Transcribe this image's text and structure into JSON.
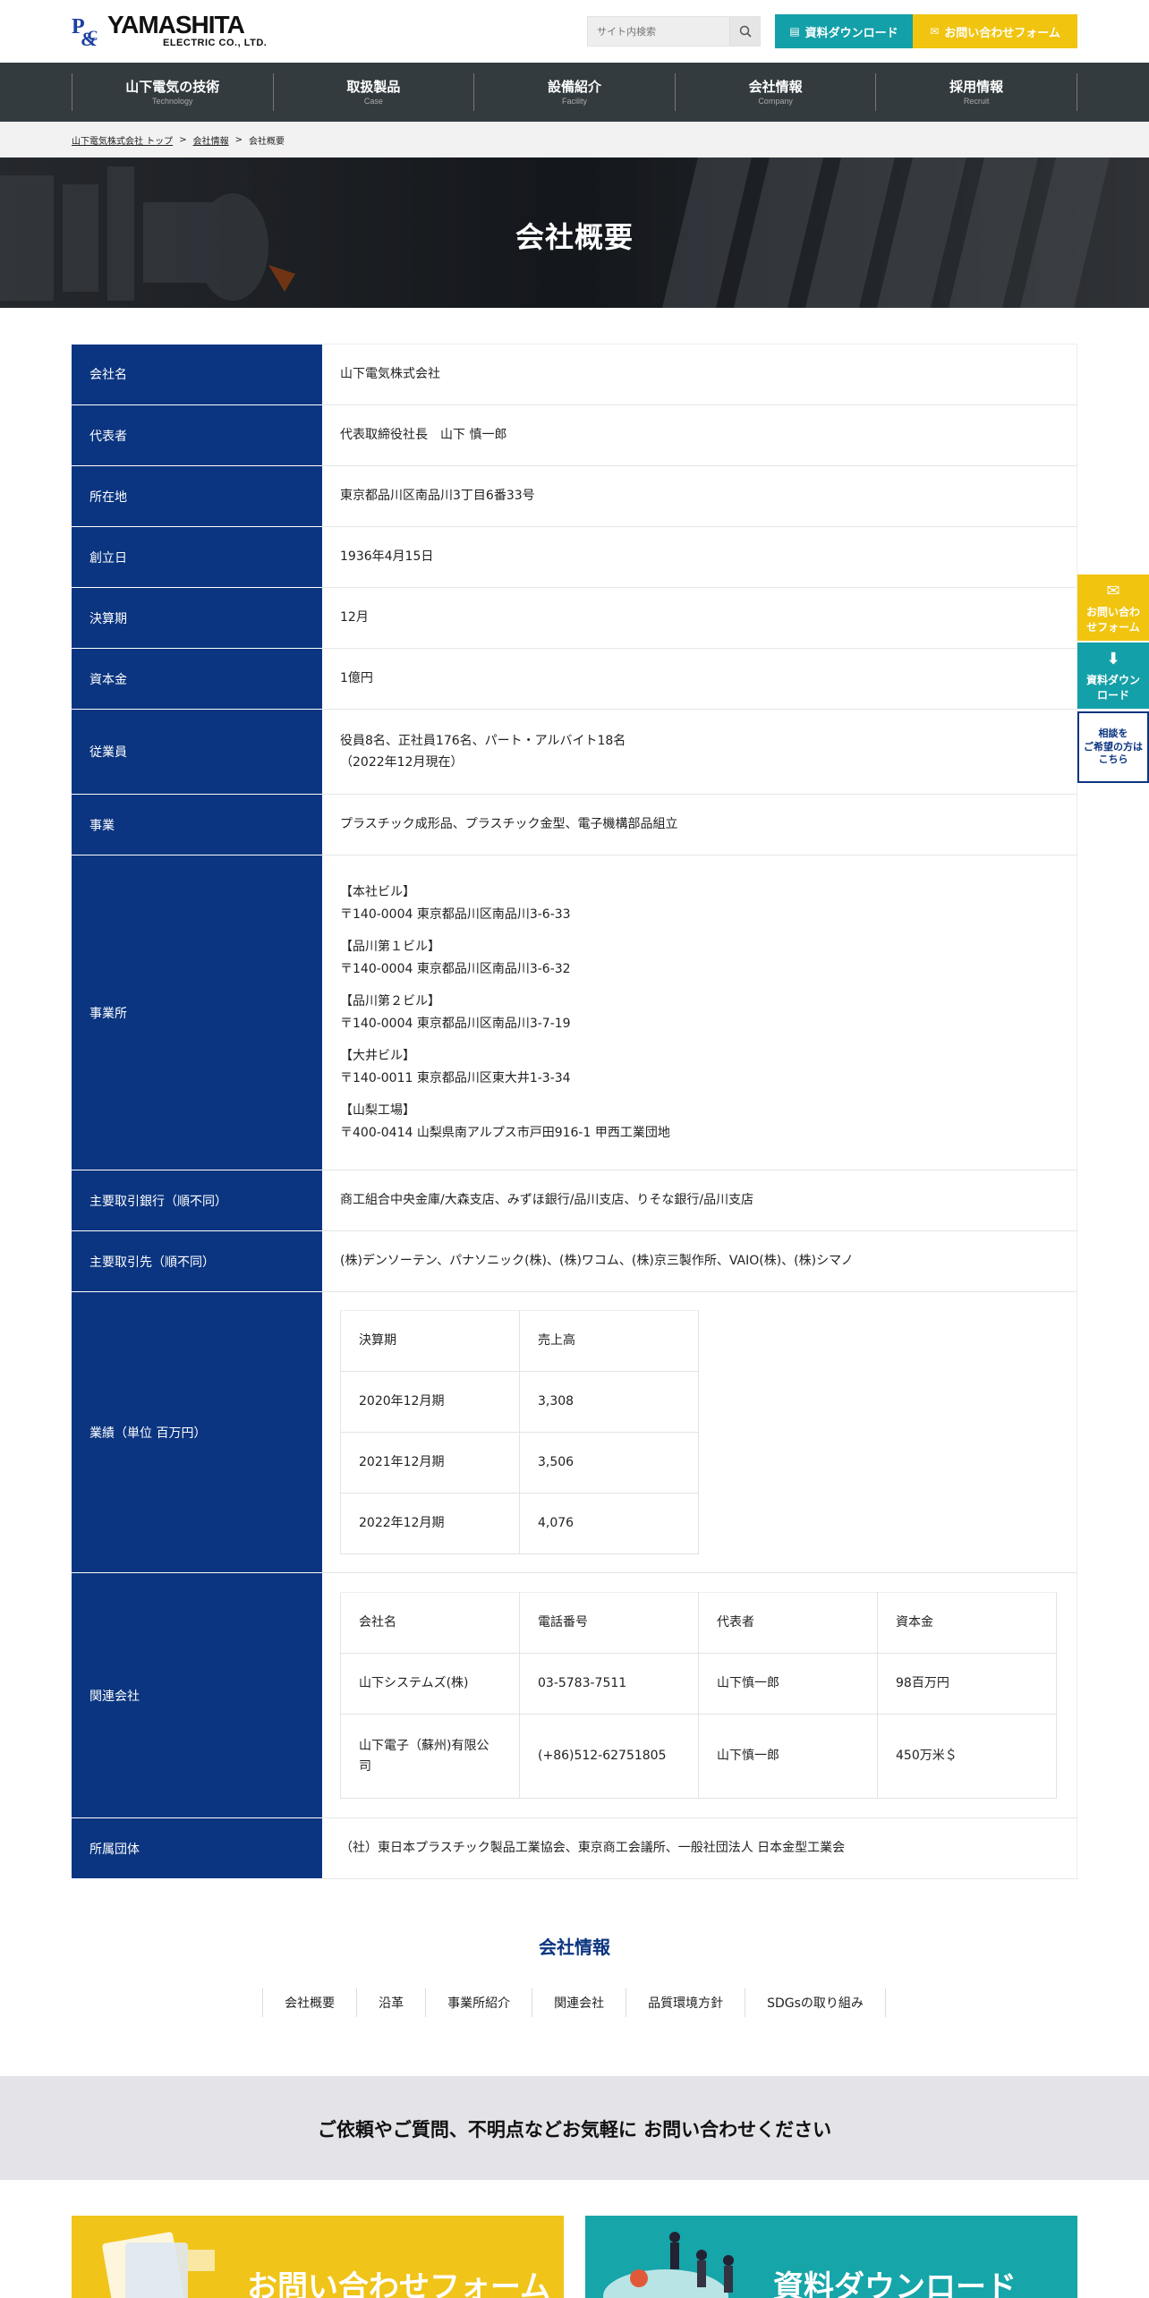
{
  "header": {
    "logo_main": "YAMASHITA",
    "logo_sub": "ELECTRIC CO., LTD.",
    "search_placeholder": "サイト内検索",
    "download_label": "資料ダウンロード",
    "contact_label": "お問い合わせフォーム"
  },
  "nav": [
    {
      "ja": "山下電気の技術",
      "en": "Technology"
    },
    {
      "ja": "取扱製品",
      "en": "Case"
    },
    {
      "ja": "設備紹介",
      "en": "Facility"
    },
    {
      "ja": "会社情報",
      "en": "Company"
    },
    {
      "ja": "採用情報",
      "en": "Recruit"
    }
  ],
  "breadcrumb": {
    "home": "山下電気株式会社 トップ",
    "parent": "会社情報",
    "current": "会社概要",
    "sep": ">"
  },
  "hero": {
    "title": "会社概要"
  },
  "profile": {
    "name": {
      "label": "会社名",
      "value": "山下電気株式会社"
    },
    "rep": {
      "label": "代表者",
      "value": "代表取締役社長　山下 慎一郎"
    },
    "address": {
      "label": "所在地",
      "value": "東京都品川区南品川3丁目6番33号"
    },
    "founded": {
      "label": "創立日",
      "value": "1936年4月15日"
    },
    "fiscal": {
      "label": "決算期",
      "value": "12月"
    },
    "capital": {
      "label": "資本金",
      "value": "1億円"
    },
    "employees": {
      "label": "従業員",
      "line1": "役員8名、正社員176名、パート・アルバイト18名",
      "line2": "（2022年12月現在）"
    },
    "business": {
      "label": "事業",
      "value": "プラスチック成形品、プラスチック金型、電子機構部品組立"
    },
    "offices": {
      "label": "事業所",
      "items": [
        {
          "name": "【本社ビル】",
          "addr": "〒140-0004 東京都品川区南品川3-6-33"
        },
        {
          "name": "【品川第１ビル】",
          "addr": "〒140-0004 東京都品川区南品川3-6-32"
        },
        {
          "name": "【品川第２ビル】",
          "addr": "〒140-0004 東京都品川区南品川3-7-19"
        },
        {
          "name": "【大井ビル】",
          "addr": "〒140-0011 東京都品川区東大井1-3-34"
        },
        {
          "name": "【山梨工場】",
          "addr": "〒400-0414 山梨県南アルプス市戸田916-1 甲西工業団地"
        }
      ]
    },
    "banks": {
      "label": "主要取引銀行（順不同）",
      "value": "商工組合中央金庫/大森支店、みずほ銀行/品川支店、りそな銀行/品川支店"
    },
    "clients": {
      "label": "主要取引先（順不同）",
      "value": "(株)デンソーテン、パナソニック(株)、(株)ワコム、(株)京三製作所、VAIO(株)、(株)シマノ"
    },
    "performance": {
      "label": "業績（単位 百万円）",
      "headers": [
        "決算期",
        "売上高"
      ],
      "rows": [
        [
          "2020年12月期",
          "3,308"
        ],
        [
          "2021年12月期",
          "3,506"
        ],
        [
          "2022年12月期",
          "4,076"
        ]
      ]
    },
    "related": {
      "label": "関連会社",
      "headers": [
        "会社名",
        "電話番号",
        "代表者",
        "資本金"
      ],
      "rows": [
        [
          "山下システムズ(株)",
          "03-5783-7511",
          "山下慎一郎",
          "98百万円"
        ],
        [
          "山下電子（蘇州)有限公司",
          "(+86)512-62751805",
          "山下慎一郎",
          "450万米＄"
        ]
      ]
    },
    "groups": {
      "label": "所属団体",
      "value": "（社）東日本プラスチック製品工業協会、東京商工会議所、一般社団法人 日本金型工業会"
    }
  },
  "side_tabs": {
    "contact": "お問い合わせフォーム",
    "download": "資料ダウンロード",
    "consult_l1": "相談を",
    "consult_l2": "ご希望の方は",
    "consult_l3": "こちら"
  },
  "company_info": {
    "title": "会社情報",
    "links": [
      "会社概要",
      "沿革",
      "事業所紹介",
      "関連会社",
      "品質環境方針",
      "SDGsの取り組み"
    ]
  },
  "cta": {
    "band_text": "ご依頼やご質問、不明点などお気軽に お問い合わせください",
    "card1": "お問い合わせフォーム",
    "card2": "資料ダウンロード"
  },
  "colors": {
    "navy": "#0b3580",
    "teal": "#14a0a8",
    "yellow": "#f1c40f",
    "nav_bg": "#333b3f"
  }
}
